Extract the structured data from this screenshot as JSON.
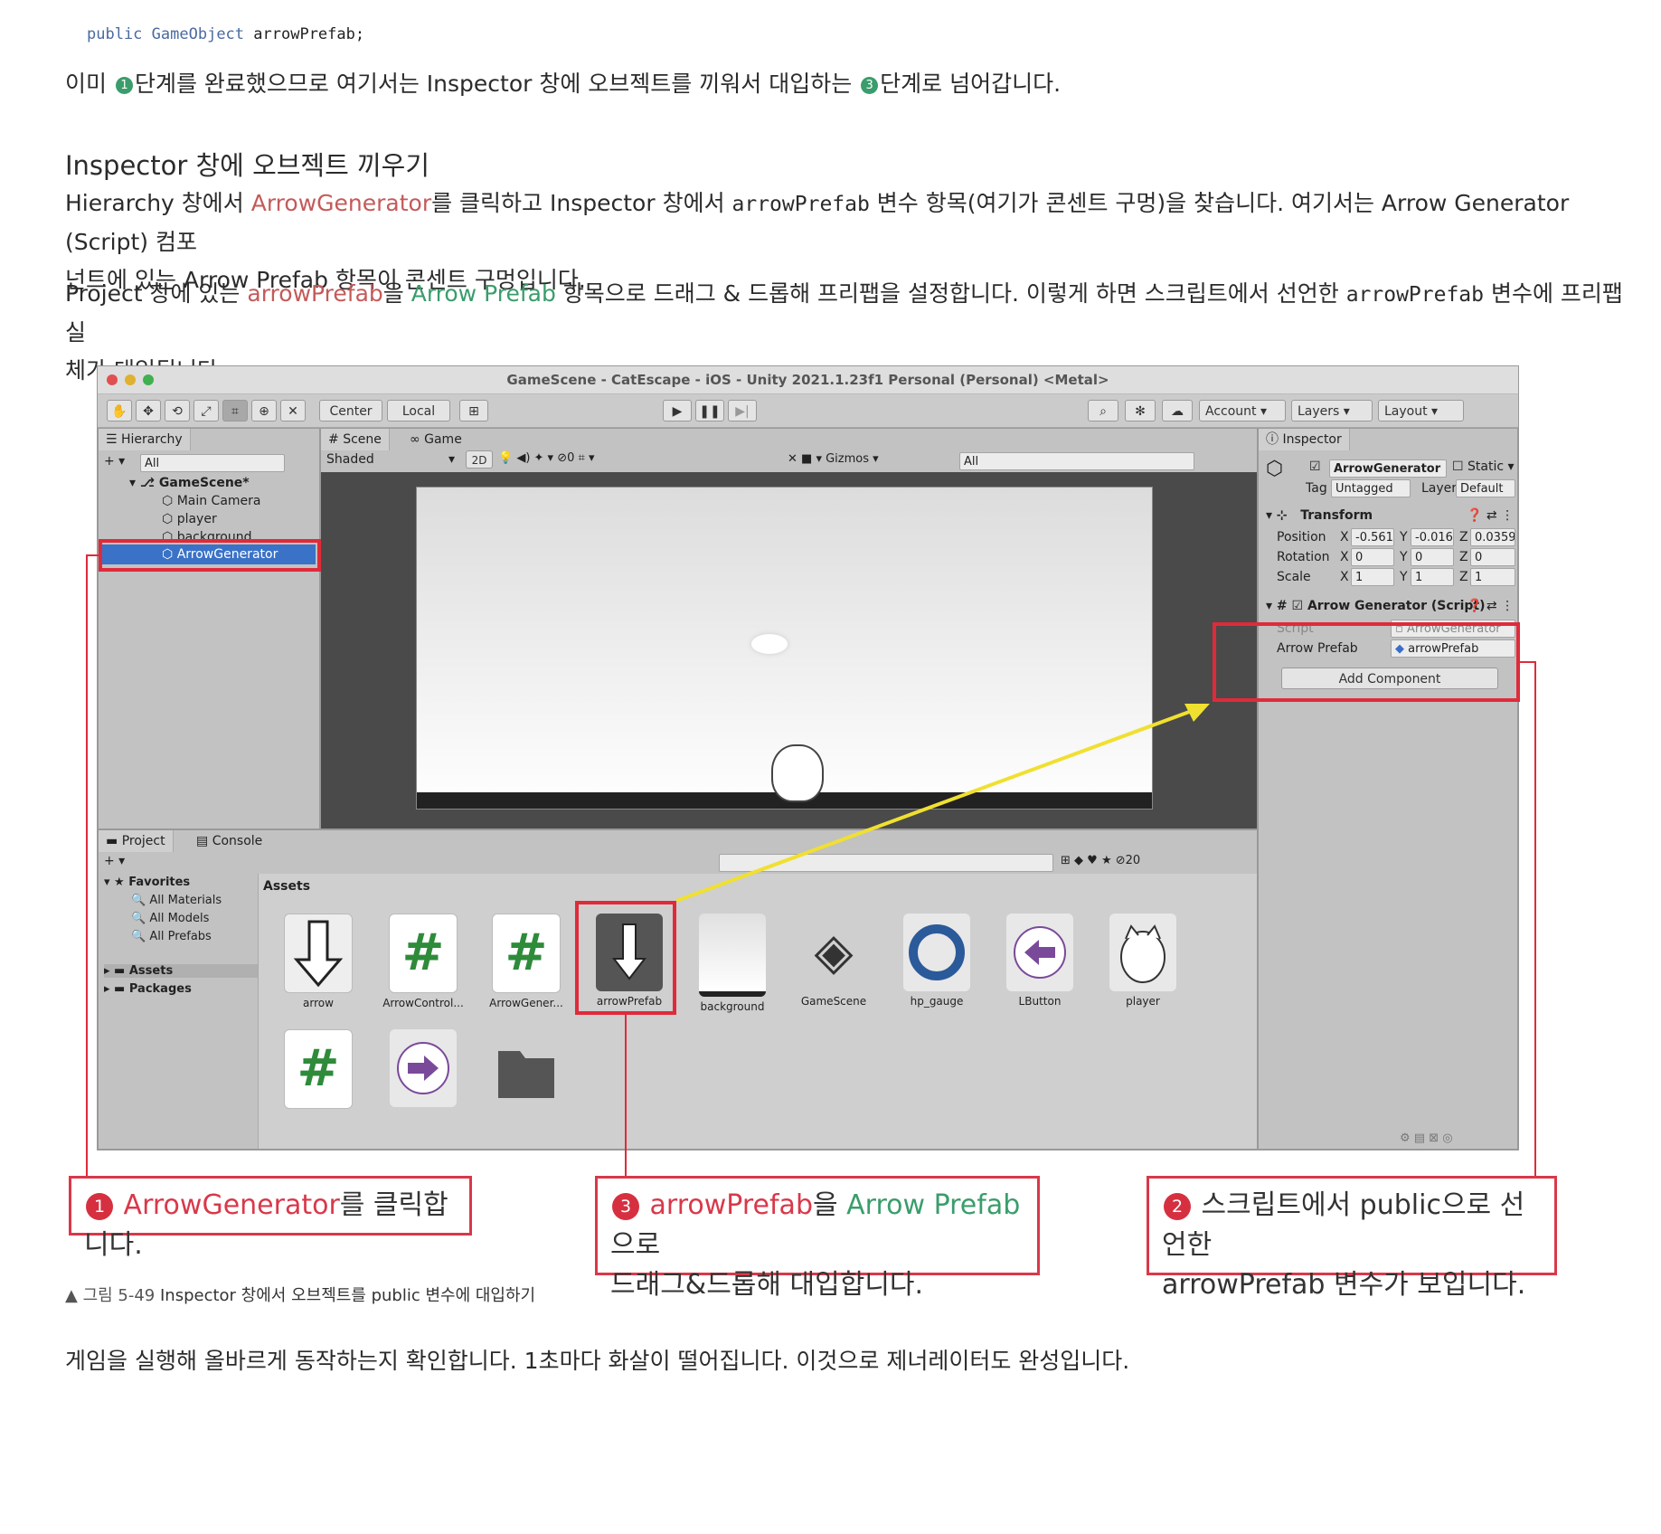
{
  "code_line": {
    "kw": "public",
    "type": "GameObject",
    "rest": "arrowPrefab;"
  },
  "intro": {
    "p1": "이미 ",
    "n1": "1",
    "p2": "단계를 완료했으므로 여기서는 Inspector 창에 오브젝트를 끼워서 대입하는 ",
    "n2": "3",
    "p3": "단계로 넘어갑니다."
  },
  "heading": "Inspector 창에 오브젝트 끼우기",
  "para1": {
    "a": "Hierarchy 창에서 ",
    "b": "ArrowGenerator",
    "c": "를 클릭하고 Inspector 창에서 ",
    "d": "arrowPrefab",
    "e": " 변수 항목(여기가 콘센트 구멍)을 찾습니다. 여기서는 Arrow Generator (Script) 컴포",
    "line2": "넌트에 있는 Arrow Prefab 항목이 콘센트 구멍입니다."
  },
  "para2": {
    "a": "Project 창에 있는 ",
    "b": "arrowPrefab",
    "c": "을 ",
    "d": "Arrow Prefab",
    "e": " 항목으로 드래그 & 드롭해 프리팹을 설정합니다. 이렇게 하면 스크립트에서 선언한 ",
    "f": "arrowPrefab",
    "g": " 변수에 프리팹 실",
    "line2": "체가 대입됩니다."
  },
  "unity": {
    "title": "GameScene - CatEscape - iOS - Unity 2021.1.23f1 Personal (Personal) <Metal>",
    "toolbar": {
      "center": "Center",
      "local": "Local",
      "account": "Account",
      "layers": "Layers",
      "layout": "Layout"
    },
    "hierarchy": {
      "tab": "Hierarchy",
      "search": "All",
      "scene": "GameScene*",
      "items": [
        "Main Camera",
        "player",
        "background",
        "ArrowGenerator"
      ]
    },
    "scene": {
      "tab_scene": "Scene",
      "tab_game": "Game",
      "shading": "Shaded",
      "mode2d": "2D",
      "gizmos": "Gizmos",
      "search": "All",
      "hidden_count": "0"
    },
    "inspector": {
      "tab": "Inspector",
      "object_name": "ArrowGenerator",
      "static": "Static",
      "tag_label": "Tag",
      "tag": "Untagged",
      "layer_label": "Layer",
      "layer": "Default",
      "transform": "Transform",
      "position_label": "Position",
      "px": "-0.5616",
      "py": "-0.016",
      "pz": "0.0359",
      "rotation_label": "Rotation",
      "rx": "0",
      "ry": "0",
      "rz": "0",
      "scale_label": "Scale",
      "sx": "1",
      "sy": "1",
      "sz": "1",
      "script_component": "Arrow Generator (Script)",
      "script_label": "Script",
      "script_value": "ArrowGenerator",
      "prefab_label": "Arrow Prefab",
      "prefab_value": "arrowPrefab",
      "add_component": "Add Component"
    },
    "project": {
      "tab_project": "Project",
      "tab_console": "Console",
      "count": "20",
      "favorites": "Favorites",
      "fav_items": [
        "All Materials",
        "All Models",
        "All Prefabs"
      ],
      "folders": [
        "Assets",
        "Packages"
      ],
      "breadcrumb": "Assets",
      "assets": [
        "arrow",
        "ArrowControl...",
        "ArrowGener...",
        "arrowPrefab",
        "background",
        "GameScene",
        "hp_gauge",
        "LButton",
        "player"
      ]
    }
  },
  "callouts": {
    "c1": {
      "num": "1",
      "red": "ArrowGenerator",
      "rest": "를 클릭합니다."
    },
    "c3": {
      "num": "3",
      "red": "arrowPrefab",
      "mid": "을 ",
      "green": "Arrow Prefab",
      "end": "으로",
      "line2": "드래그&드롭해 대입합니다."
    },
    "c2": {
      "num": "2",
      "line1": "스크립트에서 public으로 선언한",
      "line2": "arrowPrefab 변수가 보입니다."
    }
  },
  "caption": {
    "prefix": "▲ 그림 5-49",
    "text": " Inspector 창에서 오브젝트를 public 변수에 대입하기"
  },
  "closing": "게임을 실행해 올바르게 동작하는지 확인합니다. 1초마다 화살이 떨어집니다. 이것으로 제너레이터도 완성입니다.",
  "colors": {
    "highlight": "#e02a3a",
    "link_red": "#c45a5a",
    "link_green": "#3a9d6b",
    "arrow_yellow": "#f0e030"
  }
}
